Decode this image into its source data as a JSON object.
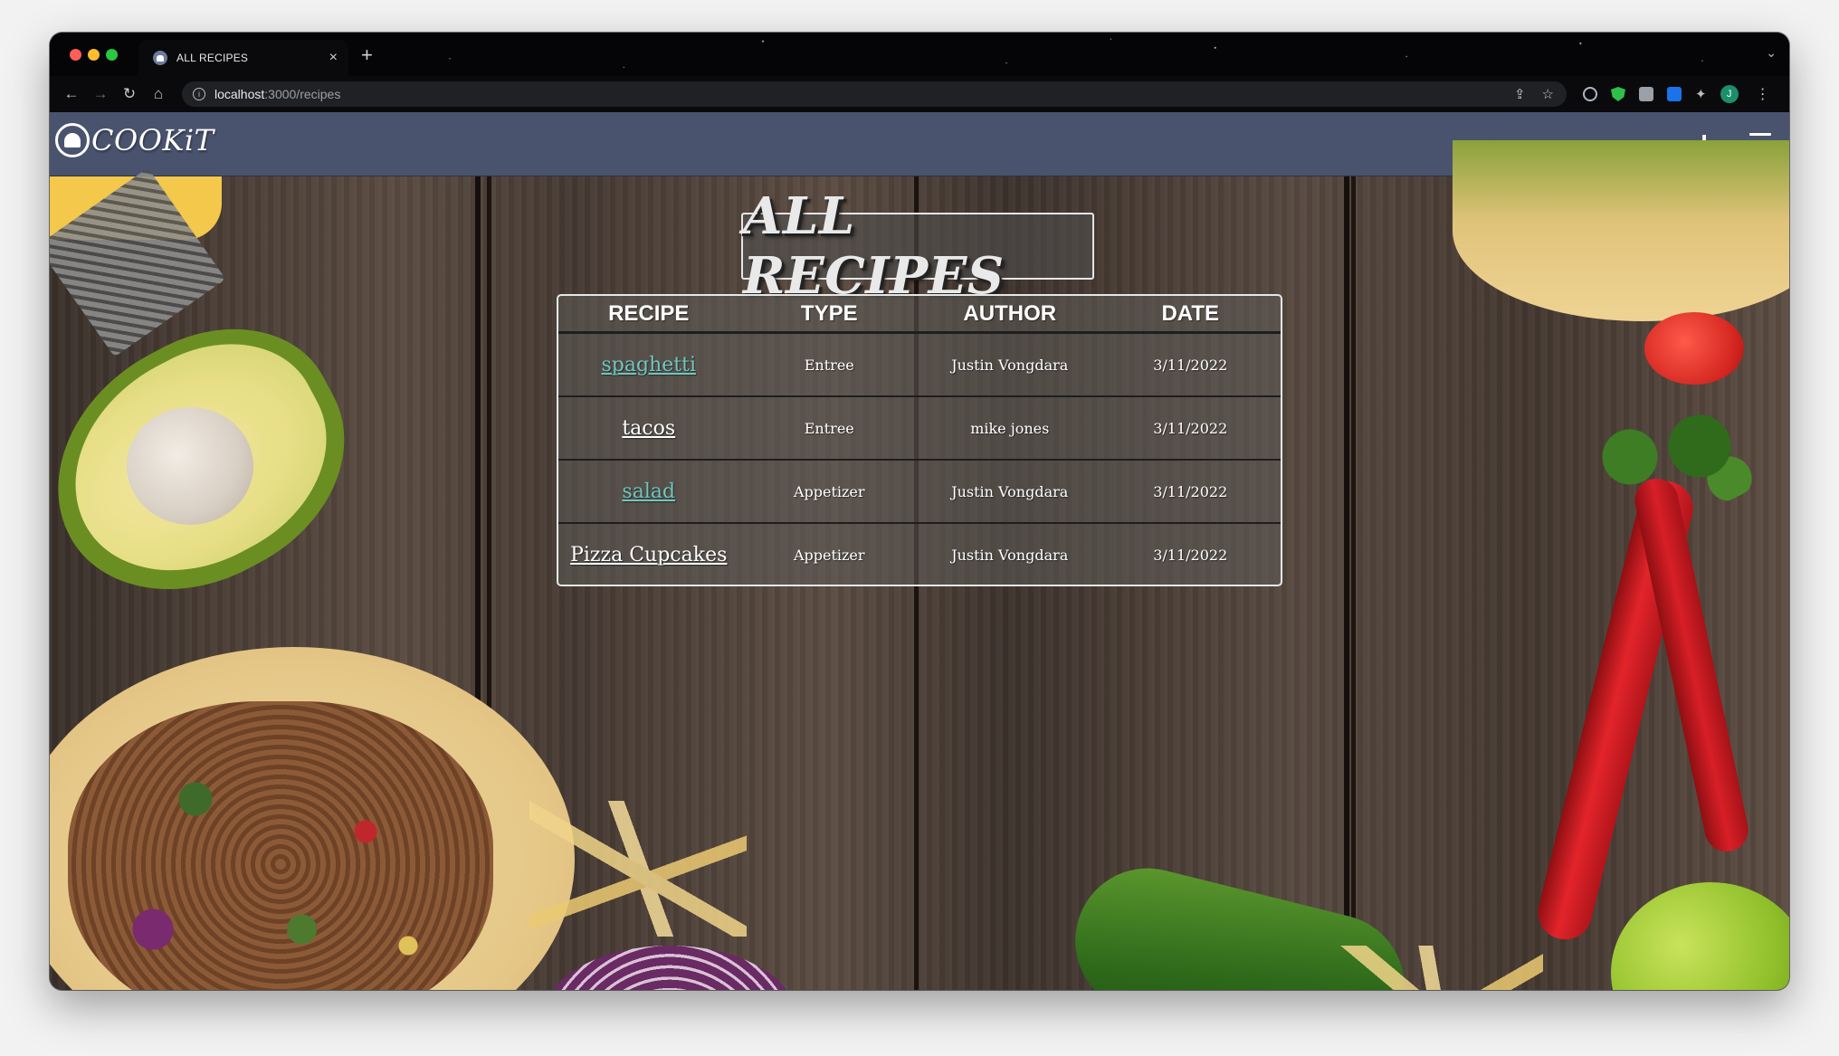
{
  "browser": {
    "tab_title": "ALL RECIPES",
    "tab_close": "×",
    "new_tab": "+",
    "url_host": "localhost",
    "url_path": ":3000/recipes",
    "avatar_initial": "J"
  },
  "app": {
    "logo_text": "COOKiT",
    "add_icon": "+",
    "colors": {
      "navbar": "#4a536e",
      "link_visited": "#6fc7bf",
      "link_default": "#ffffff"
    }
  },
  "page": {
    "title": "ALL RECIPES",
    "table": {
      "headers": [
        "RECIPE",
        "TYPE",
        "AUTHOR",
        "DATE"
      ],
      "rows": [
        {
          "recipe": "spaghetti",
          "type": "Entree",
          "author": "Justin Vongdara",
          "date": "3/11/2022",
          "link_state": "visited"
        },
        {
          "recipe": "tacos",
          "type": "Entree",
          "author": "mike jones",
          "date": "3/11/2022",
          "link_state": "default"
        },
        {
          "recipe": "salad",
          "type": "Appetizer",
          "author": "Justin Vongdara",
          "date": "3/11/2022",
          "link_state": "visited"
        },
        {
          "recipe": "Pizza Cupcakes",
          "type": "Appetizer",
          "author": "Justin Vongdara",
          "date": "3/11/2022",
          "link_state": "default"
        }
      ]
    }
  }
}
